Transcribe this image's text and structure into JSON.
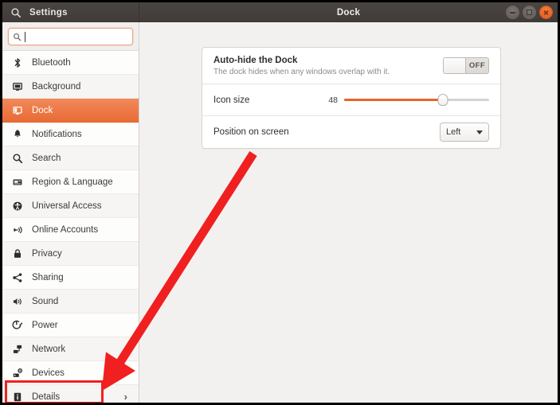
{
  "window": {
    "title_left": "Settings",
    "title_center": "Dock",
    "search_icon": "search-icon",
    "buttons": {
      "minimize": "minimize-button",
      "maximize": "maximize-button",
      "close": "close-button"
    }
  },
  "sidebar": {
    "search": {
      "value": "",
      "placeholder": "",
      "icon": "search-icon"
    },
    "items": [
      {
        "label": "Bluetooth",
        "icon": "bluetooth-icon",
        "selected": false,
        "chevron": ""
      },
      {
        "label": "Background",
        "icon": "monitor-icon",
        "selected": false,
        "chevron": ""
      },
      {
        "label": "Dock",
        "icon": "dock-icon",
        "selected": true,
        "chevron": ""
      },
      {
        "label": "Notifications",
        "icon": "bell-icon",
        "selected": false,
        "chevron": ""
      },
      {
        "label": "Search",
        "icon": "search-icon",
        "selected": false,
        "chevron": ""
      },
      {
        "label": "Region & Language",
        "icon": "keyboard-icon",
        "selected": false,
        "chevron": ""
      },
      {
        "label": "Universal Access",
        "icon": "accessibility-icon",
        "selected": false,
        "chevron": ""
      },
      {
        "label": "Online Accounts",
        "icon": "online-accounts-icon",
        "selected": false,
        "chevron": ""
      },
      {
        "label": "Privacy",
        "icon": "privacy-lock-icon",
        "selected": false,
        "chevron": ""
      },
      {
        "label": "Sharing",
        "icon": "share-icon",
        "selected": false,
        "chevron": ""
      },
      {
        "label": "Sound",
        "icon": "speaker-icon",
        "selected": false,
        "chevron": ""
      },
      {
        "label": "Power",
        "icon": "power-icon",
        "selected": false,
        "chevron": ""
      },
      {
        "label": "Network",
        "icon": "network-icon",
        "selected": false,
        "chevron": ""
      },
      {
        "label": "Devices",
        "icon": "devices-icon",
        "selected": false,
        "chevron": "›"
      },
      {
        "label": "Details",
        "icon": "details-info-icon",
        "selected": false,
        "chevron": "›"
      }
    ]
  },
  "main": {
    "autohide": {
      "title": "Auto-hide the Dock",
      "subtitle": "The dock hides when any windows overlap with it.",
      "toggle_state": "OFF"
    },
    "icon_size": {
      "label": "Icon size",
      "value": "48",
      "fill_percent": 68
    },
    "position": {
      "label": "Position on screen",
      "selected": "Left"
    }
  },
  "annotations": {
    "arrow_color": "#f02020",
    "highlight_color": "#f02020",
    "points_at": "Details"
  },
  "colors": {
    "accent_orange": "#e9632a",
    "selected_row": "#e96c35",
    "titlebar": "#403b38",
    "content_bg": "#f2f1f0"
  }
}
